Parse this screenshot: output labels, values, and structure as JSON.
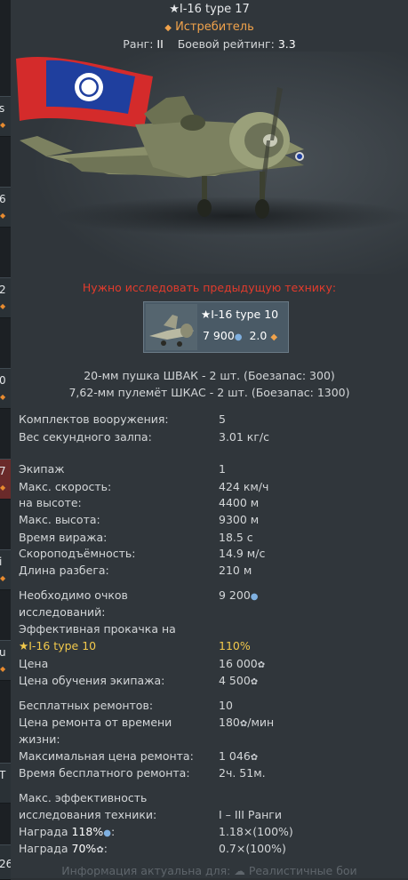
{
  "header": {
    "title": "I-16 type 17",
    "class_label": "Истребитель",
    "rank_label": "Ранг:",
    "rank_value": "II",
    "br_label": "Боевой рейтинг:",
    "br_value": "3.3"
  },
  "left_tabs": [
    "s",
    "6",
    "2",
    "0",
    "7",
    "i",
    "u",
    "T",
    "26"
  ],
  "research_warning": "Нужно исследовать предыдущую технику:",
  "prev_vehicle": {
    "name": "I-16 type 10",
    "rp_cost": "7 900",
    "br": "2.0"
  },
  "armament": [
    "20-мм пушка ШВАК - 2 шт. (Боезапас: 300)",
    "7,62-мм пулемёт ШКАС - 2 шт. (Боезапас: 1300)"
  ],
  "stats": {
    "presets_label": "Комплектов вооружения:",
    "presets_value": "5",
    "burst_label": "Вес секундного залпа:",
    "burst_value": "3.01 кг/с",
    "crew_label": "Экипаж",
    "crew_value": "1",
    "speed_label": "Макс. скорость:",
    "speed_value": "424 км/ч",
    "at_alt_label": "на высоте:",
    "at_alt_value": "4400 м",
    "ceiling_label": "Макс. высота:",
    "ceiling_value": "9300 м",
    "turn_label": "Время виража:",
    "turn_value": "18.5 с",
    "climb_label": "Скороподъёмность:",
    "climb_value": "14.9 м/с",
    "takeoff_label": "Длина разбега:",
    "takeoff_value": "210 м"
  },
  "economy": {
    "rp_needed_label_1": "Необходимо очков",
    "rp_needed_label_2": "исследований:",
    "rp_needed_value": "9 200",
    "eff_label": "Эффективная прокачка на",
    "eff_vehicle": "I-16 type 10",
    "eff_value": "110%",
    "price_label": "Цена",
    "price_value": "16 000",
    "crew_train_label": "Цена обучения экипажа:",
    "crew_train_value": "4 500",
    "free_repairs_label": "Бесплатных ремонтов:",
    "free_repairs_value": "10",
    "repair_time_label_1": "Цена ремонта от времени",
    "repair_time_label_2": "жизни:",
    "repair_time_value": "180",
    "repair_time_unit": "/мин",
    "max_repair_label": "Максимальная цена ремонта:",
    "max_repair_value": "1 046",
    "free_repair_time_label": "Время бесплатного ремонта:",
    "free_repair_time_value": "2ч. 51м.",
    "max_eff_label_1": "Макс. эффективность",
    "max_eff_label_2": "исследования техники:",
    "max_eff_value": "I – III Ранги",
    "reward_label": "Награда",
    "reward_rp_pct": "118%",
    "reward_rp_value": "1.18×(100%)",
    "reward_sl_pct": "70%",
    "reward_sl_value": "0.7×(100%)"
  },
  "footer": "Информация актуальна для: ☁ Реалистичные бои",
  "colors": {
    "accent_orange": "#f0a24b",
    "warning_red": "#e23b2c",
    "gold": "#f2c94c",
    "rp_blue": "#7fb0e0",
    "panel_bg": "#30363b"
  }
}
